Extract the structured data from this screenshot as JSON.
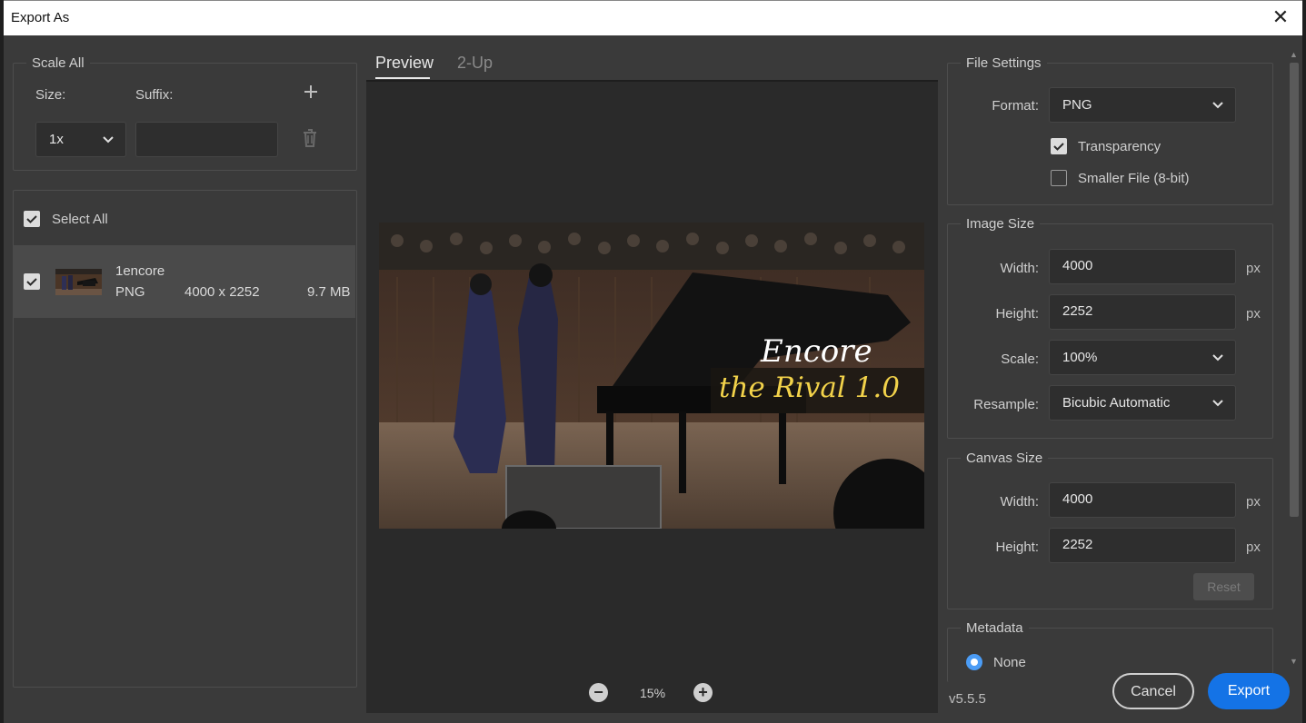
{
  "window": {
    "title": "Export As",
    "close_icon": "close-icon"
  },
  "scale_all": {
    "legend": "Scale All",
    "size_label": "Size:",
    "suffix_label": "Suffix:",
    "size_value": "1x",
    "suffix_value": ""
  },
  "assets": {
    "select_all_label": "Select All",
    "select_all_checked": true,
    "items": [
      {
        "name": "1encore",
        "format": "PNG",
        "dimensions": "4000 x 2252",
        "size": "9.7 MB",
        "checked": true
      }
    ]
  },
  "preview": {
    "tabs": [
      "Preview",
      "2-Up"
    ],
    "active_tab": "Preview",
    "image_text_line1": "Encore",
    "image_text_line2": "the Rival 1.0",
    "zoom": "15%"
  },
  "file_settings": {
    "legend": "File Settings",
    "format_label": "Format:",
    "format_value": "PNG",
    "transparency_label": "Transparency",
    "transparency_checked": true,
    "smaller_file_label": "Smaller File (8-bit)",
    "smaller_file_checked": false
  },
  "image_size": {
    "legend": "Image Size",
    "width_label": "Width:",
    "width_value": "4000",
    "height_label": "Height:",
    "height_value": "2252",
    "scale_label": "Scale:",
    "scale_value": "100%",
    "resample_label": "Resample:",
    "resample_value": "Bicubic Automatic",
    "unit": "px"
  },
  "canvas_size": {
    "legend": "Canvas Size",
    "width_label": "Width:",
    "width_value": "4000",
    "height_label": "Height:",
    "height_value": "2252",
    "unit": "px",
    "reset_label": "Reset"
  },
  "metadata": {
    "legend": "Metadata",
    "none_label": "None"
  },
  "footer": {
    "version": "v5.5.5",
    "cancel_label": "Cancel",
    "export_label": "Export"
  },
  "colors": {
    "accent": "#1473e6",
    "radio": "#4b9cf5"
  }
}
